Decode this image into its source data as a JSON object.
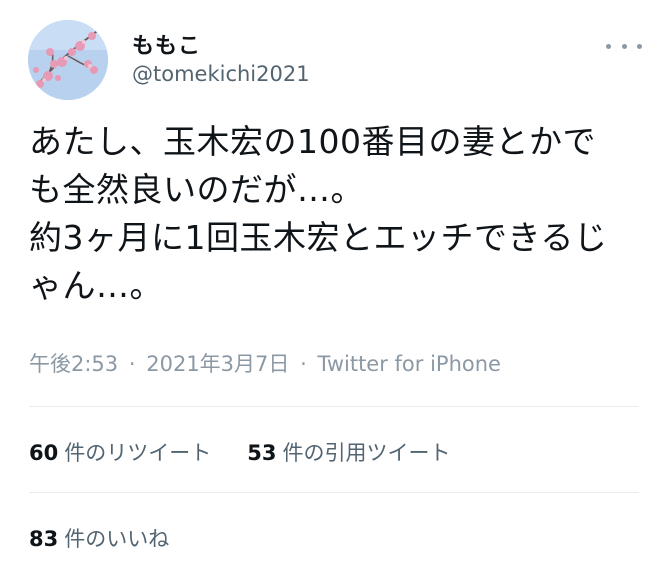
{
  "user": {
    "name": "ももこ",
    "handle": "@tomekichi2021"
  },
  "tweet": {
    "lines": [
      "あたし、玉木宏の100番目の妻とかで",
      "も全然良いのだが…。",
      "約3ヶ月に1回玉木宏とエッチできるじ",
      "ゃん…。"
    ]
  },
  "meta": {
    "time": "午後2:53",
    "separator": "·",
    "date": "2021年3月7日",
    "source": "Twitter for iPhone"
  },
  "stats": {
    "retweets": {
      "count": "60",
      "label": "件のリツイート"
    },
    "quotes": {
      "count": "53",
      "label": "件の引用ツイート"
    },
    "likes": {
      "count": "83",
      "label": "件のいいね"
    }
  },
  "icons": {
    "more": "more-horizontal-icon"
  },
  "colors": {
    "text": "#0f1419",
    "secondary": "#536471",
    "muted": "#8b98a5",
    "divider": "#e6ecf0"
  }
}
